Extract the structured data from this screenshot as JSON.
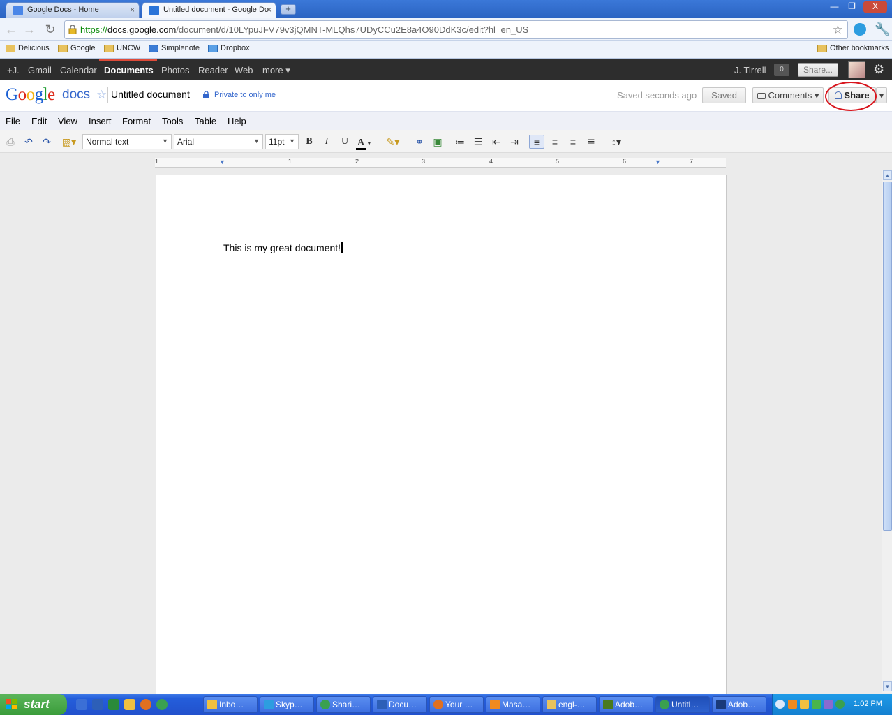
{
  "browser": {
    "tabs": [
      {
        "title": "Google Docs - Home",
        "active": false
      },
      {
        "title": "Untitled document - Google Do",
        "active": true
      }
    ],
    "window_controls": {
      "minimize": "—",
      "restore": "❐",
      "close": "X"
    },
    "url": {
      "scheme": "https://",
      "host": "docs.google.com",
      "path": "/document/d/10LYpuJFV79v3jQMNT-MLQhs7UDyCCu2E8a4O90DdK3c/edit?hl=en_US"
    },
    "bookmarks": [
      "Delicious",
      "Google",
      "UNCW",
      "Simplenote",
      "Dropbox"
    ],
    "other_bookmarks": "Other bookmarks"
  },
  "gbar": {
    "items": [
      "+J.",
      "Gmail",
      "Calendar",
      "Documents",
      "Photos",
      "Reader",
      "Web",
      "more ▾"
    ],
    "active": "Documents",
    "user": "J. Tirrell",
    "notifications": "0",
    "share": "Share..."
  },
  "docs": {
    "logo": {
      "g1": "G",
      "o1": "o",
      "o2": "o",
      "g2": "g",
      "l": "l",
      "e": "e"
    },
    "product": "docs",
    "title": "Untitled document",
    "privacy": "Private to only me",
    "save_status": "Saved seconds ago",
    "saved_button": "Saved",
    "comments_button": "Comments ▾",
    "share_button": "Share",
    "share_dropdown": "▾"
  },
  "menus": [
    "File",
    "Edit",
    "View",
    "Insert",
    "Format",
    "Tools",
    "Table",
    "Help"
  ],
  "toolbar": {
    "style": "Normal text",
    "font": "Arial",
    "size": "11pt",
    "bold": "B",
    "italic": "I",
    "underline": "U",
    "text_color": "A"
  },
  "ruler": {
    "numbers": [
      "1",
      "1",
      "2",
      "3",
      "4",
      "5",
      "6",
      "7"
    ]
  },
  "document": {
    "text": "This is my great document!"
  },
  "taskbar": {
    "start": "start",
    "tasks": [
      "Inbo…",
      "Skyp…",
      "Shari…",
      "Docu…",
      "Your …",
      "Masa…",
      "engl-…",
      "Adob…",
      "Untitl…",
      "Adob…"
    ],
    "active_task": "Untitl…",
    "clock": "1:02 PM"
  },
  "colors": {
    "gbar_bg": "#2d2d2d",
    "gbar_active_underline": "#dd4b39",
    "docs_blue": "#3366cc",
    "share_highlight": "#d8141c",
    "xp_taskbar": "#245edb",
    "xp_start": "#3a9c3a"
  }
}
